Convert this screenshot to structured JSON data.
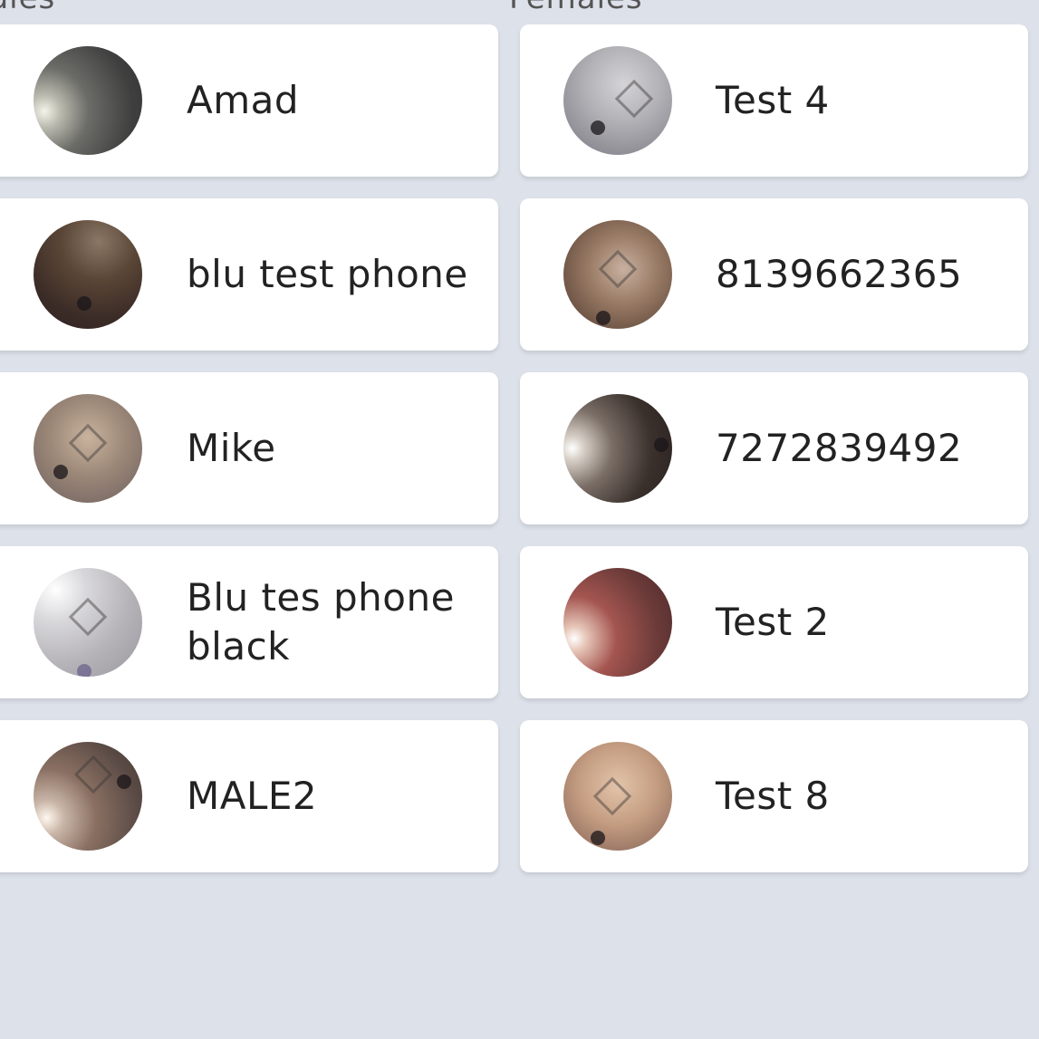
{
  "columns": {
    "males_header": "Males",
    "females_header": "Females"
  },
  "males": [
    {
      "name": "Amad",
      "avatar": "av-dark-glow"
    },
    {
      "name": "blu test phone",
      "avatar": "av-brown-texture"
    },
    {
      "name": "Mike",
      "avatar": "av-tile-beige"
    },
    {
      "name": "Blu tes phone black",
      "avatar": "av-tile-grey"
    },
    {
      "name": "MALE2",
      "avatar": "av-tile-dark-glow"
    }
  ],
  "females": [
    {
      "name": "Test 4",
      "avatar": "av-grey-tile"
    },
    {
      "name": "8139662365",
      "avatar": "av-brown-tile"
    },
    {
      "name": "7272839492",
      "avatar": "av-dark-flash"
    },
    {
      "name": "Test 2",
      "avatar": "av-red-flash"
    },
    {
      "name": "Test 8",
      "avatar": "av-tan"
    }
  ],
  "colors": {
    "background": "#dde1ea",
    "card": "#ffffff",
    "text": "#222222"
  }
}
